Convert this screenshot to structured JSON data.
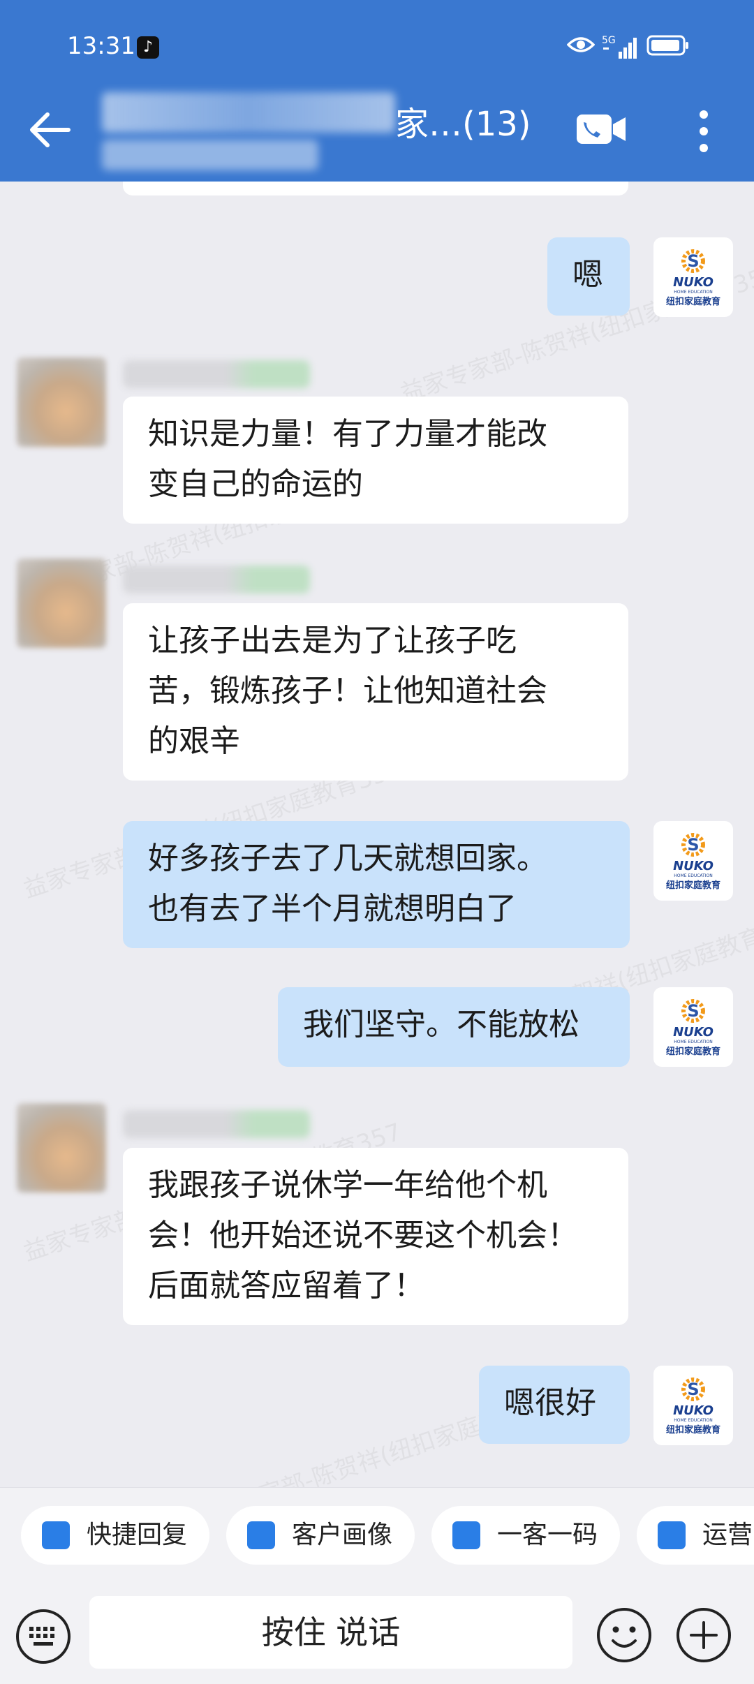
{
  "status_bar": {
    "time": "13:31",
    "network": "5G"
  },
  "header": {
    "title": "家…(13)"
  },
  "messages": [
    {
      "dir": "out",
      "text": "嗯"
    },
    {
      "dir": "in",
      "text": "知识是力量！有了力量才能改\n变自己的命运的"
    },
    {
      "dir": "in",
      "text": "让孩子出去是为了让孩子吃\n苦，锻炼孩子！让他知道社会\n的艰辛"
    },
    {
      "dir": "out",
      "text": "好多孩子去了几天就想回家。\n也有去了半个月就想明白了"
    },
    {
      "dir": "out",
      "text": "我们坚守。不能放松"
    },
    {
      "dir": "in",
      "text": "我跟孩子说休学一年给他个机\n会！他开始还说不要这个机会！\n后面就答应留着了！"
    },
    {
      "dir": "out",
      "text": "嗯很好"
    }
  ],
  "avatar_brand": {
    "name": "NUKO",
    "subtitle": "HOME EDUCATION",
    "caption": "纽扣家庭教育"
  },
  "watermark": "益家专家部-陈贺祥(纽扣家庭教育357",
  "quick_chips": [
    "快捷回复",
    "客户画像",
    "一客一码",
    "运营"
  ],
  "input": {
    "voice_label": "按住 说话"
  },
  "colors": {
    "header": "#3a78d0",
    "out_bubble": "#c9e2fb",
    "in_bubble": "#ffffff",
    "check": "#2a7ee6"
  }
}
